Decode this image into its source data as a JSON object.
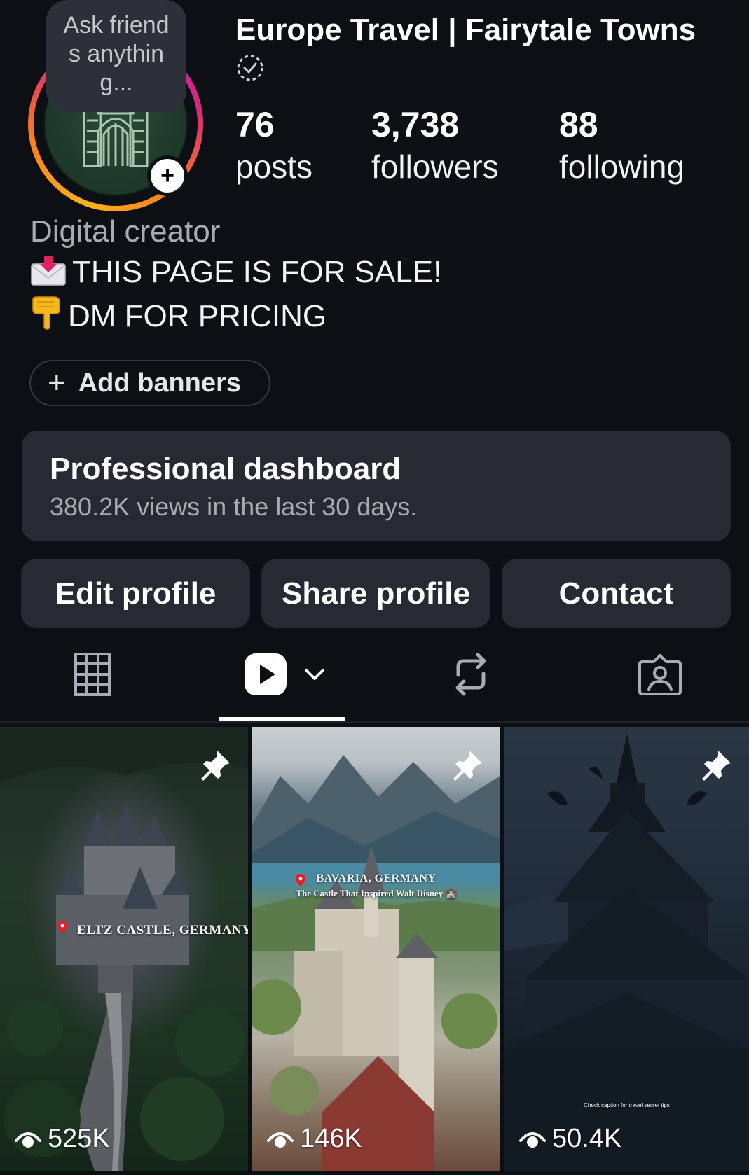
{
  "profile": {
    "note": "Ask friends anything...",
    "account_name": "Europe Travel | Fairytale Towns",
    "verified_icon": "dashed-circle-check-icon",
    "stats": {
      "posts": {
        "value": "76",
        "label": "posts"
      },
      "followers": {
        "value": "3,738",
        "label": "followers"
      },
      "following": {
        "value": "88",
        "label": "following"
      }
    },
    "category": "Digital creator",
    "bio": {
      "line1": "THIS PAGE IS FOR SALE!",
      "line1_icon": "incoming-envelope-emoji",
      "line2": "DM FOR PRICING",
      "line2_icon": "pointing-down-hand-emoji"
    },
    "add_banners_label": "Add banners"
  },
  "dashboard": {
    "title": "Professional dashboard",
    "subtitle": "380.2K views in the last 30 days."
  },
  "actions": {
    "edit": "Edit profile",
    "share": "Share profile",
    "contact": "Contact"
  },
  "tabs": [
    {
      "name": "grid",
      "icon": "grid-icon"
    },
    {
      "name": "reels",
      "icon": "reels-play-icon",
      "active": true
    },
    {
      "name": "reposts",
      "icon": "repost-icon"
    },
    {
      "name": "tagged",
      "icon": "tagged-person-icon"
    }
  ],
  "reels": [
    {
      "views": "525K",
      "pinned": true,
      "overlay": "ELTZ CASTLE, GERMANY"
    },
    {
      "views": "146K",
      "pinned": true,
      "overlay_title": "BAVARIA, GERMANY",
      "overlay_sub": "The Castle That Inspired Walt Disney 🏰"
    },
    {
      "views": "50.4K",
      "pinned": true,
      "overlay": "Check caption for travel secret tips"
    }
  ],
  "colors": {
    "background": "#0c0f14",
    "card": "#262a32",
    "muted_text": "#a8abb2"
  }
}
